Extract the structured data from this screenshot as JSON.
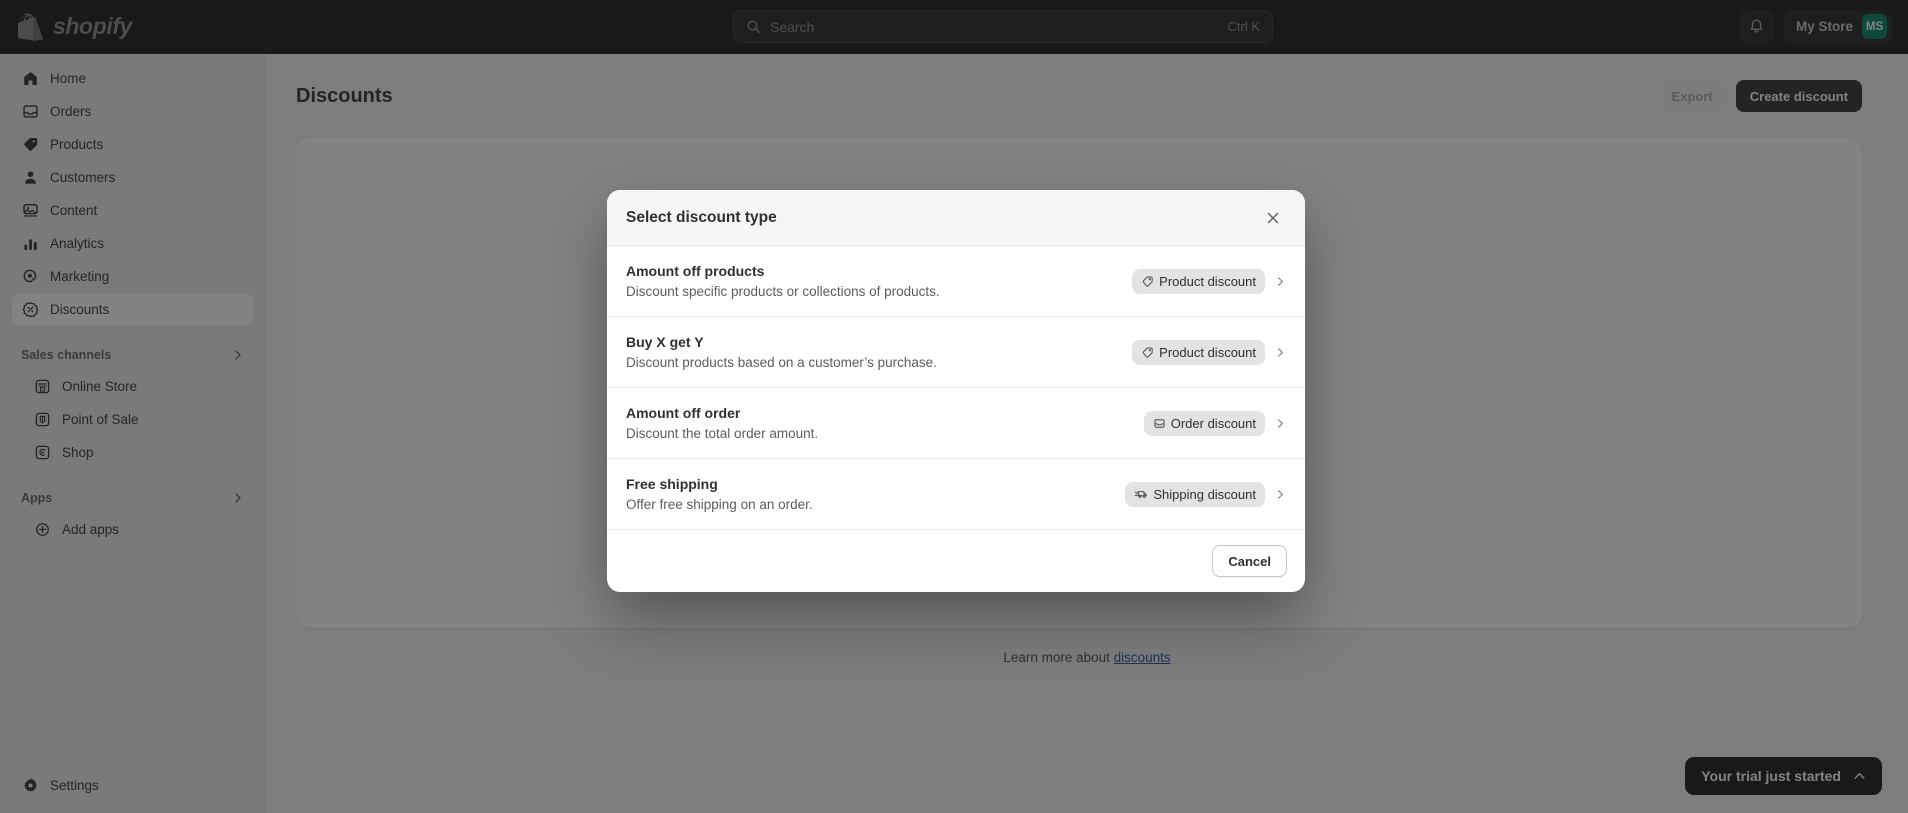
{
  "topbar": {
    "brand": "shopify",
    "search": {
      "placeholder": "Search",
      "shortcut": "Ctrl K",
      "icon": "search-icon"
    },
    "notifications_icon": "bell-icon",
    "store_name": "My Store",
    "avatar_initials": "MS"
  },
  "sidebar": {
    "items": [
      {
        "label": "Home",
        "icon": "home-icon",
        "active": false
      },
      {
        "label": "Orders",
        "icon": "orders-icon",
        "active": false
      },
      {
        "label": "Products",
        "icon": "tag-icon",
        "active": false
      },
      {
        "label": "Customers",
        "icon": "person-icon",
        "active": false
      },
      {
        "label": "Content",
        "icon": "image-icon",
        "active": false
      },
      {
        "label": "Analytics",
        "icon": "bar-chart-icon",
        "active": false
      },
      {
        "label": "Marketing",
        "icon": "target-icon",
        "active": false
      },
      {
        "label": "Discounts",
        "icon": "discount-badge-icon",
        "active": true
      }
    ],
    "sales_channels": {
      "title": "Sales channels",
      "chevron": "chevron-right-icon",
      "items": [
        {
          "label": "Online Store",
          "icon": "storefront-icon"
        },
        {
          "label": "Point of Sale",
          "icon": "pos-icon"
        },
        {
          "label": "Shop",
          "icon": "shop-icon"
        }
      ]
    },
    "apps": {
      "title": "Apps",
      "chevron": "chevron-right-icon",
      "items": [
        {
          "label": "Add apps",
          "icon": "plus-circle-icon"
        }
      ]
    },
    "settings": {
      "label": "Settings",
      "icon": "gear-icon"
    }
  },
  "page": {
    "title": "Discounts",
    "export_label": "Export",
    "create_label": "Create discount",
    "learn_prefix": "Learn more about ",
    "learn_link": "discounts"
  },
  "modal": {
    "title": "Select discount type",
    "close_icon": "close-icon",
    "options": [
      {
        "title": "Amount off products",
        "description": "Discount specific products or collections of products.",
        "badge": "Product discount",
        "badge_icon": "tag-outline-icon",
        "chevron": "chevron-right-icon"
      },
      {
        "title": "Buy X get Y",
        "description": "Discount products based on a customer’s purchase.",
        "badge": "Product discount",
        "badge_icon": "tag-outline-icon",
        "chevron": "chevron-right-icon"
      },
      {
        "title": "Amount off order",
        "description": "Discount the total order amount.",
        "badge": "Order discount",
        "badge_icon": "order-outline-icon",
        "chevron": "chevron-right-icon"
      },
      {
        "title": "Free shipping",
        "description": "Offer free shipping on an order.",
        "badge": "Shipping discount",
        "badge_icon": "truck-outline-icon",
        "chevron": "chevron-right-icon"
      }
    ],
    "cancel_label": "Cancel"
  },
  "trial": {
    "label": "Your trial just started",
    "icon": "chevron-up-icon"
  },
  "colors": {
    "brand_green": "#008060",
    "link_blue": "#1f5199",
    "dark": "#1a1a1a",
    "sidebar_bg": "#ebebeb"
  }
}
